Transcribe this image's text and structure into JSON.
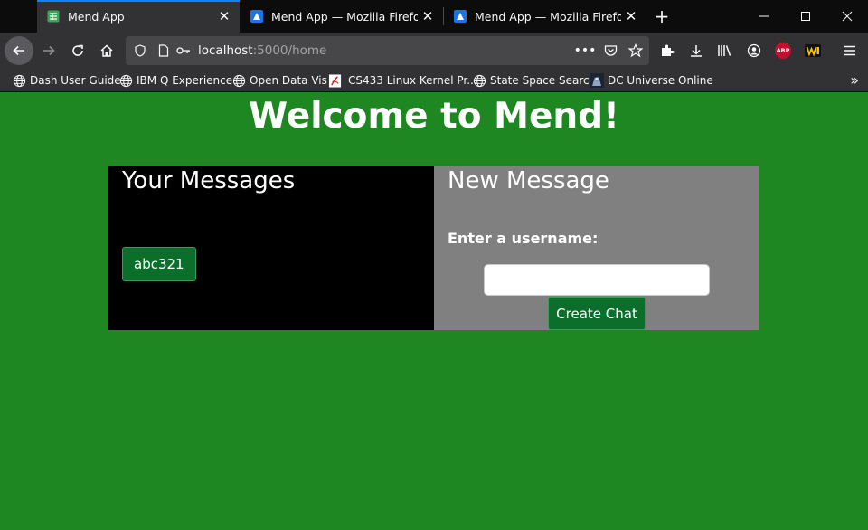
{
  "browser": {
    "tabs": [
      {
        "title": "Mend App",
        "favicon": "spreadsheet-icon",
        "active": true
      },
      {
        "title": "Mend App — Mozilla Firefox",
        "favicon": "app-logo-icon",
        "active": false
      },
      {
        "title": "Mend App — Mozilla Firefox",
        "favicon": "app-logo-icon",
        "active": false
      }
    ],
    "url_host": "localhost",
    "url_path": ":5000/home",
    "bookmarks": [
      {
        "label": "Dash User Guide",
        "icon": "globe-icon"
      },
      {
        "label": "IBM Q Experience",
        "icon": "globe-icon"
      },
      {
        "label": "Open Data Vis",
        "icon": "globe-icon"
      },
      {
        "label": "CS433 Linux Kernel Pr...",
        "icon": "pdf-icon"
      },
      {
        "label": "State Space Search",
        "icon": "globe-icon"
      },
      {
        "label": "DC Universe Online",
        "icon": "game-icon"
      }
    ],
    "extensions": {
      "adblock_label": "ABP"
    }
  },
  "page": {
    "title": "Welcome to Mend!",
    "messages": {
      "heading": "Your Messages",
      "chats": [
        "abc321"
      ]
    },
    "new_message": {
      "heading": "New Message",
      "username_label": "Enter a username:",
      "username_value": "",
      "create_button": "Create Chat"
    }
  },
  "colors": {
    "page_background": "#1f8722",
    "button_green": "#0b6e2b",
    "left_panel": "#000000",
    "right_panel": "#808080"
  }
}
